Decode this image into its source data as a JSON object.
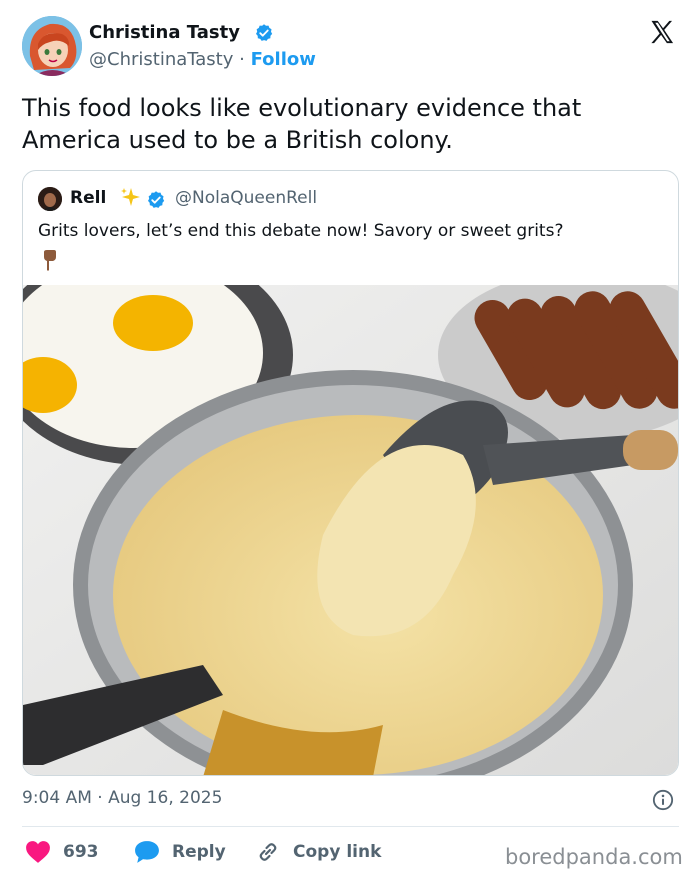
{
  "author": {
    "name": "Christina Tasty",
    "handle": "@ChristinaTasty",
    "separator": "·",
    "follow_label": "Follow",
    "verified": true
  },
  "tweet": {
    "text": "This food looks like evolutionary evidence that America used to be a British colony."
  },
  "quoted": {
    "name": "Rell",
    "handle": "@NolaQueenRell",
    "verified": true,
    "text": "Grits lovers, let’s end this debate now! Savory or sweet grits?",
    "emoji_icons": [
      "sparkles-icon",
      "pointing-down-hand-icon"
    ],
    "image_alt": "pan of creamy grits with spoon, fried eggs and sausages"
  },
  "meta": {
    "timestamp": "9:04 AM · Aug 16, 2025"
  },
  "actions": {
    "like_count": "693",
    "reply_label": "Reply",
    "copy_label": "Copy link"
  },
  "watermark": "boredpanda.com",
  "colors": {
    "accent": "#1d9bf0",
    "like": "#f91880",
    "text": "#0f1419",
    "muted": "#536471"
  }
}
